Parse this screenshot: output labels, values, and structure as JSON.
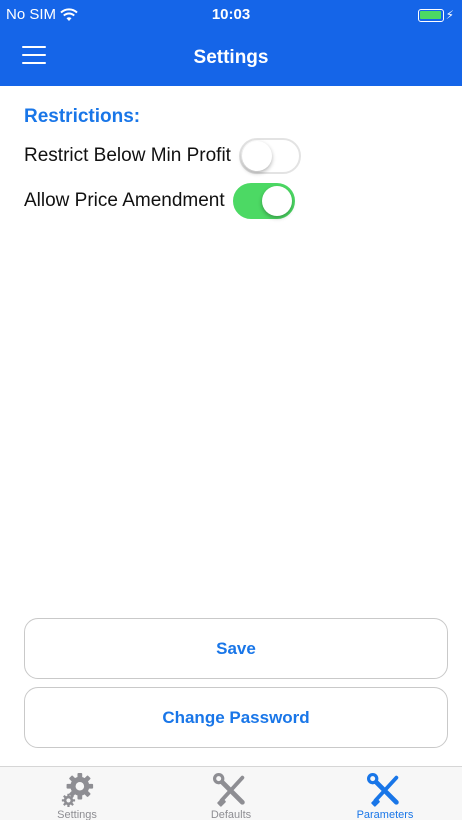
{
  "status_bar": {
    "carrier": "No SIM",
    "time": "10:03",
    "battery_color": "#4cd964",
    "icons": [
      "wifi-icon",
      "battery-icon",
      "charging-bolt-icon"
    ]
  },
  "nav": {
    "title": "Settings",
    "menu_icon": "hamburger-menu-icon",
    "background": "#1565e8"
  },
  "restrictions": {
    "heading": "Restrictions:",
    "items": [
      {
        "label": "Restrict Below Min Profit",
        "enabled": false
      },
      {
        "label": "Allow Price Amendment",
        "enabled": true
      }
    ]
  },
  "buttons": {
    "save": "Save",
    "change_password": "Change Password"
  },
  "tab_bar": {
    "tabs": [
      {
        "label": "Settings",
        "icon": "gears-icon",
        "active": false
      },
      {
        "label": "Defaults",
        "icon": "tools-icon",
        "active": false
      },
      {
        "label": "Parameters",
        "icon": "tools-icon",
        "active": true
      }
    ]
  },
  "colors": {
    "accent": "#1976e8",
    "toggle_on": "#4cd964"
  }
}
